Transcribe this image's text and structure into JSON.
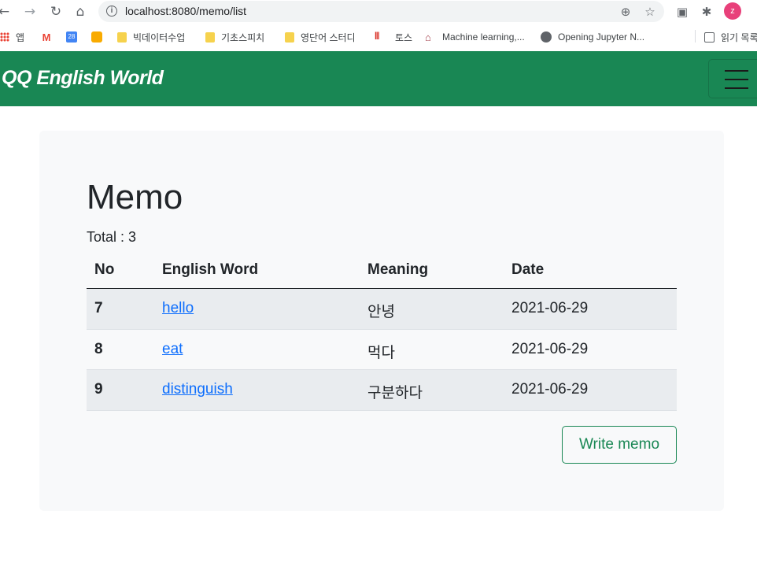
{
  "browser": {
    "url": "localhost:8080/memo/list",
    "profile_initial": "z",
    "bookmarks": [
      {
        "label": "앱",
        "icon": "apps-grid-icon"
      },
      {
        "label": "",
        "icon": "gmail-icon"
      },
      {
        "label": "",
        "icon": "calendar-icon"
      },
      {
        "label": "",
        "icon": "keep-icon"
      },
      {
        "label": "빅데이터수업",
        "icon": "folder-icon"
      },
      {
        "label": "기초스피치",
        "icon": "folder-icon"
      },
      {
        "label": "영단어 스터디",
        "icon": "folder-icon"
      },
      {
        "label": "토스",
        "icon": "toss-icon"
      },
      {
        "label": "Machine learning,...",
        "icon": "bank-icon"
      },
      {
        "label": "Opening Jupyter N...",
        "icon": "globe-icon"
      },
      {
        "label": "읽기 목록",
        "icon": "reading-list-icon"
      }
    ]
  },
  "navbar": {
    "brand": "QQ English World"
  },
  "page": {
    "title": "Memo",
    "total": "Total : 3",
    "columns": [
      "No",
      "English Word",
      "Meaning",
      "Date"
    ],
    "rows": [
      {
        "no": "7",
        "word": "hello",
        "meaning": "안녕",
        "date": "2021-06-29"
      },
      {
        "no": "8",
        "word": "eat",
        "meaning": "먹다",
        "date": "2021-06-29"
      },
      {
        "no": "9",
        "word": "distinguish",
        "meaning": "구분하다",
        "date": "2021-06-29"
      }
    ],
    "write_button": "Write memo"
  },
  "colors": {
    "navbar": "#198754",
    "link": "#0d6efd",
    "card_bg": "#f8f9fa",
    "stripe": "#e9ecef"
  }
}
